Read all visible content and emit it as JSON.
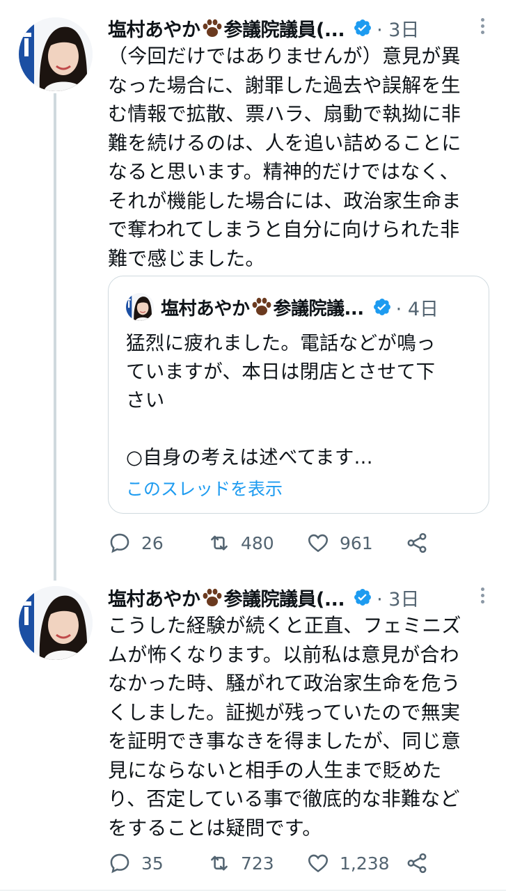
{
  "tweets": [
    {
      "author": "塩村あやか",
      "author_suffix": "参議院議員(...",
      "time": "· 3日",
      "text_lines": [
        "（今回だけではありませんが）意見が異",
        "なった場合に、謝罪した過去や誤解を生",
        "む情報で拡散、票ハラ、扇動で執拗に非",
        "難を続けるのは、人を追い詰めることに",
        "なると思います。精神的だけではなく、",
        "それが機能した場合には、政治家生命ま",
        "で奪われてしまうと自分に向けられた非",
        "難で感じました。"
      ],
      "quote": {
        "author": "塩村あやか",
        "author_suffix": "参議院議...",
        "time": "· 4日",
        "text_lines": [
          "猛烈に疲れました。電話などが鳴っ",
          "ていますが、本日は閉店とさせて下",
          "さい",
          "",
          "○自身の考えは述べてます..."
        ],
        "show_thread": "このスレッドを表示"
      },
      "replies": "26",
      "retweets": "480",
      "likes": "961"
    },
    {
      "author": "塩村あやか",
      "author_suffix": "参議院議員(...",
      "time": "· 3日",
      "text_lines": [
        "こうした経験が続くと正直、フェミニズ",
        "ムが怖くなります。以前私は意見が合わ",
        "なかった時、騒がれて政治家生命を危う",
        "くしました。証拠が残っていたので無実",
        "を証明でき事なきを得ましたが、同じ意",
        "見にならないと相手の人生まで貶めた",
        "り、否定している事で徹底的な非難など",
        "をすることは疑問です。"
      ],
      "replies": "35",
      "retweets": "723",
      "likes": "1,238"
    }
  ],
  "icons": {
    "reply": "reply-icon",
    "retweet": "retweet-icon",
    "like": "heart-icon",
    "share": "share-icon",
    "verified": "verified-badge-icon",
    "paw": "paw-emoji-icon",
    "more": "more-options-icon"
  },
  "colors": {
    "verified": "#1d9bf0",
    "link": "#1d9bf0",
    "muted": "#536471",
    "paw": "#6b3a1f"
  }
}
